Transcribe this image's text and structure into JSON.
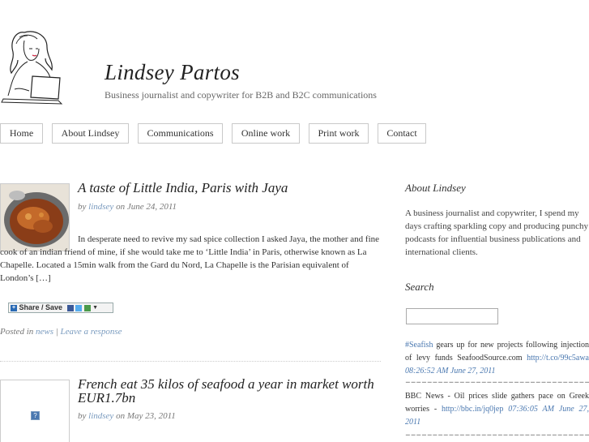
{
  "header": {
    "title": "Lindsey Partos",
    "description": "Business journalist and copywriter for B2B and B2C communications"
  },
  "nav": {
    "items": [
      "Home",
      "About Lindsey",
      "Communications",
      "Online work",
      "Print work",
      "Contact"
    ]
  },
  "posts": [
    {
      "title": "A taste of Little India, Paris with Jaya",
      "meta_by": "by",
      "author": "lindsey",
      "meta_on": "on June 24, 2011",
      "excerpt": "In desperate need to revive my sad spice collection I asked Jaya, the mother and fine cook of an indian friend of mine, if she would take me to ‘Little India’ in Paris, otherwise known as La Chapelle. Located a 15min walk from the Gard du Nord, La Chapelle is the Parisian equivalent of London’s […]",
      "share_label": "Share / Save",
      "posted_in_label": "Posted in",
      "category": "news",
      "separator": "|",
      "response_link": "Leave a response"
    },
    {
      "title": "French eat 35 kilos of seafood a year in market worth EUR1.7bn",
      "meta_by": "by",
      "author": "lindsey",
      "meta_on": "on May 23, 2011",
      "thumb_placeholder": "?"
    }
  ],
  "sidebar": {
    "about_heading": "About Lindsey",
    "about_text": "A business journalist and copywriter, I spend my days crafting sparkling copy and producing punchy podcasts for influential business publications and international clients.",
    "search_heading": "Search",
    "search_value": "",
    "tweets": [
      {
        "hashtag": "#Seafish",
        "text": " gears up for new projects following injection of levy funds SeafoodSource.com ",
        "link": "http://t.co/99c5awa",
        "time": " 08:26:52 AM June 27, 2011"
      },
      {
        "hashtag": "",
        "text": "BBC News - Oil prices slide gathers pace on Greek worries - ",
        "link": "http://bbc.in/jq0jep",
        "time": " 07:36:05 AM June 27, 2011"
      }
    ],
    "separator": "==================================================="
  }
}
